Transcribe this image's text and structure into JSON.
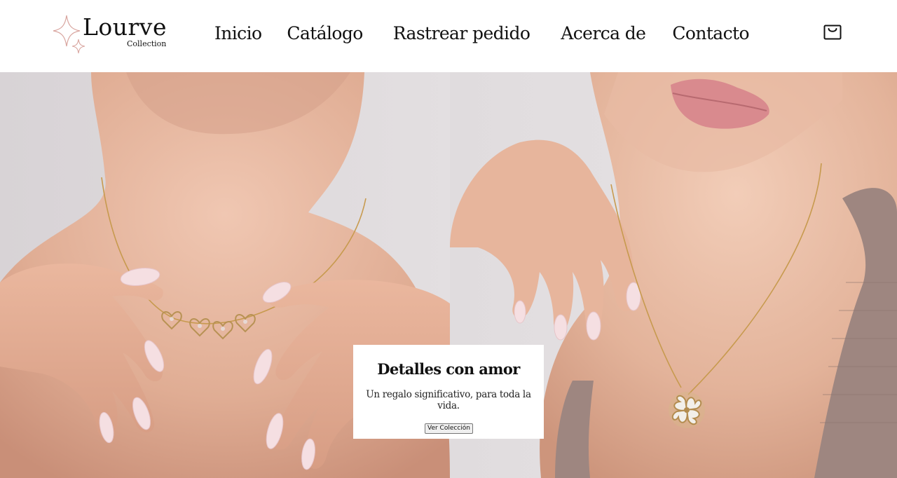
{
  "brand": {
    "name": "Lourve",
    "subtitle": "Collection"
  },
  "nav": {
    "items": [
      {
        "label": "Inicio"
      },
      {
        "label": "Catálogo"
      },
      {
        "label": "Rastrear pedido"
      },
      {
        "label": "Acerca de"
      },
      {
        "label": "Contacto"
      }
    ]
  },
  "header": {
    "cart_icon": "shopping-bag-icon"
  },
  "hero": {
    "left_image": "woman-holding-heart-necklace",
    "right_image": "woman-wearing-clover-pendant-necklace",
    "card": {
      "title": "Detalles con amor",
      "text": "Un regalo significativo, para toda la vida.",
      "button_label": "Ver Colección"
    }
  },
  "colors": {
    "header_bg": "#ffffff",
    "logo_star": "#d9a6a0",
    "skin": "#e6b49b",
    "background_left": "#dcd6d8",
    "background_right": "#e4e0e2"
  }
}
